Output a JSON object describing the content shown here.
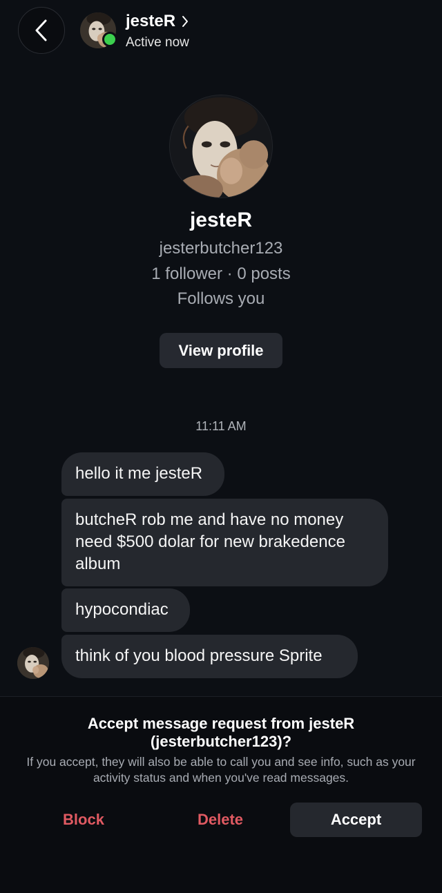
{
  "header": {
    "name": "jesteR",
    "status": "Active now",
    "online_color": "#3ccf4e"
  },
  "profile": {
    "name": "jesteR",
    "username": "jesterbutcher123",
    "stats": "1 follower · 0 posts",
    "follows": "Follows you",
    "view_profile_label": "View profile"
  },
  "thread": {
    "timestamp": "11:11 AM",
    "messages": [
      {
        "text": "hello it me jesteR"
      },
      {
        "text": "butcheR rob me and have no money need $500 dolar for new brakedence album"
      },
      {
        "text": "hypocondiac"
      },
      {
        "text": "think of you blood pressure Sprite"
      }
    ]
  },
  "request": {
    "title": "Accept message request from jesteR (jesterbutcher123)?",
    "description": "If you accept, they will also be able to call you and see info, such as your activity status and when you've read messages.",
    "block_label": "Block",
    "delete_label": "Delete",
    "accept_label": "Accept",
    "danger_color": "#e05a62"
  },
  "icons": {
    "back": "chevron-left-icon",
    "header_chevron": "chevron-right-icon"
  }
}
